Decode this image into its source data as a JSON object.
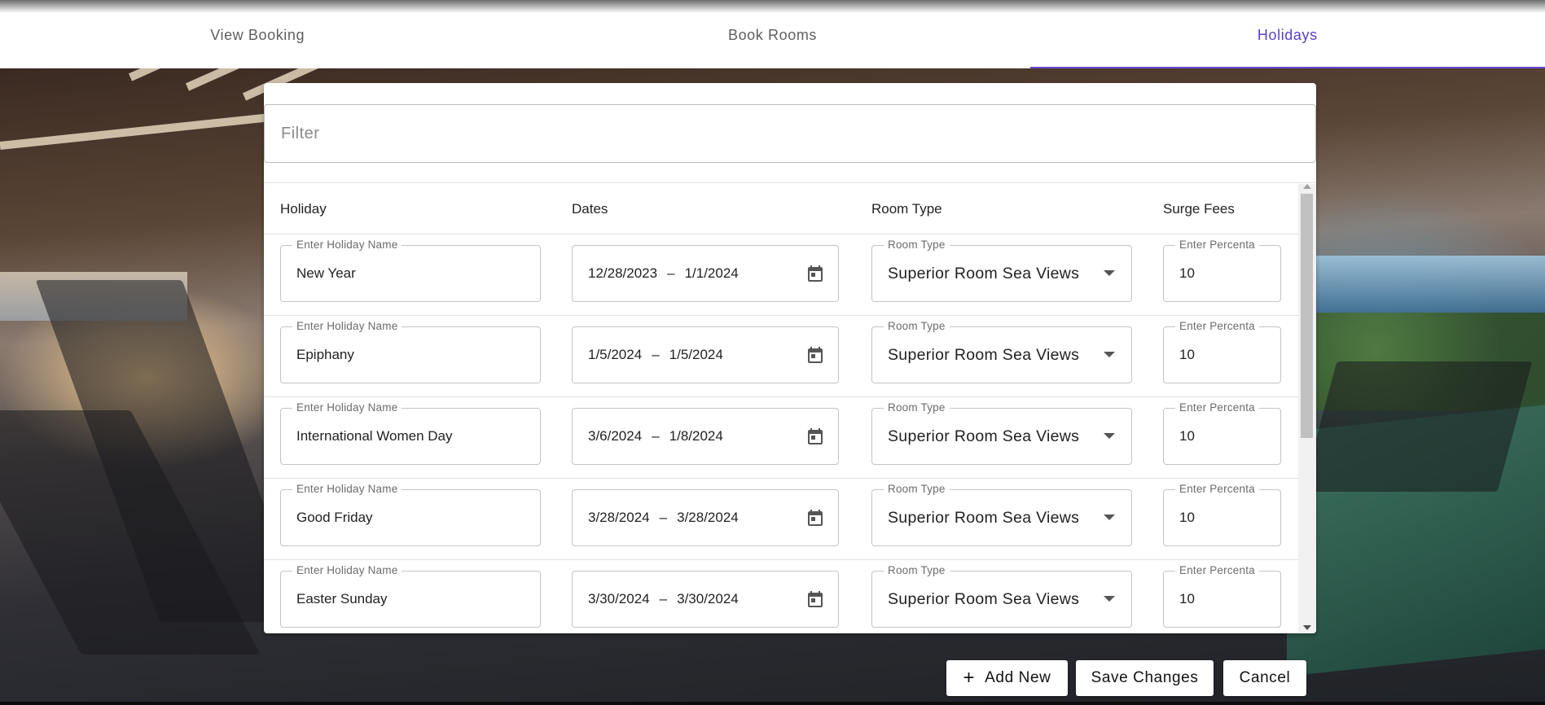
{
  "tabs": [
    {
      "label": "View Booking",
      "active": false
    },
    {
      "label": "Book Rooms",
      "active": false
    },
    {
      "label": "Holidays",
      "active": true
    }
  ],
  "filter": {
    "placeholder": "Filter"
  },
  "table": {
    "headers": {
      "holiday": "Holiday",
      "dates": "Dates",
      "room_type": "Room Type",
      "surge_fees": "Surge Fees"
    },
    "field_labels": {
      "holiday": "Enter Holiday Name",
      "room_type": "Room Type",
      "surge": "Enter Percenta"
    },
    "rows": [
      {
        "holiday": "New Year",
        "date_start": "12/28/2023",
        "date_end": "1/1/2024",
        "room_type": "Superior Room Sea Views",
        "surge": "10"
      },
      {
        "holiday": "Epiphany",
        "date_start": "1/5/2024",
        "date_end": "1/5/2024",
        "room_type": "Superior Room Sea Views",
        "surge": "10"
      },
      {
        "holiday": "International Women Day",
        "date_start": "3/6/2024",
        "date_end": "1/8/2024",
        "room_type": "Superior Room Sea Views",
        "surge": "10"
      },
      {
        "holiday": "Good Friday",
        "date_start": "3/28/2024",
        "date_end": "3/28/2024",
        "room_type": "Superior Room Sea Views",
        "surge": "10"
      },
      {
        "holiday": "Easter Sunday",
        "date_start": "3/30/2024",
        "date_end": "3/30/2024",
        "room_type": "Superior Room Sea Views",
        "surge": "10"
      }
    ],
    "date_separator": "–"
  },
  "actions": {
    "add_new": "Add New",
    "save_changes": "Save Changes",
    "cancel": "Cancel"
  },
  "icons": {
    "calendar": "calendar-icon",
    "dropdown": "chevron-down-icon",
    "plus": "plus-icon"
  },
  "colors": {
    "accent": "#5b3fc4"
  }
}
